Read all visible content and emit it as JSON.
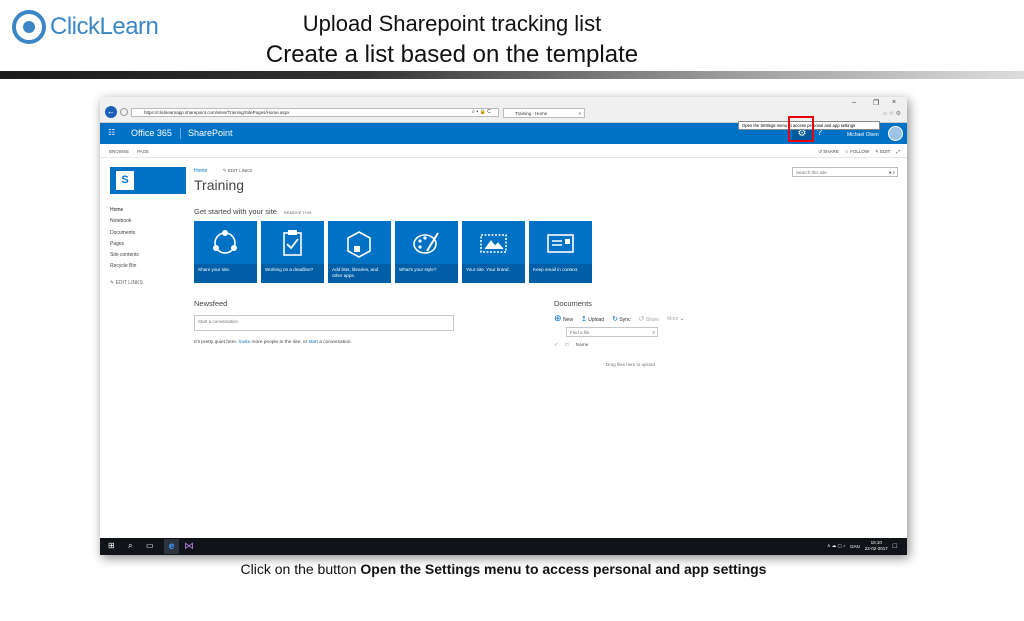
{
  "brand": {
    "logo_text": "ClickLearn"
  },
  "slide": {
    "title": "Upload Sharepoint tracking list",
    "subtitle": "Create a list based on the template",
    "caption_prefix": "Click on the button",
    "caption_target": "Open the Settings menu to access personal and app settings"
  },
  "browser": {
    "url": "https://clicklearnapp.sharepoint.com/sites/Training/SitePages/Home.aspx",
    "address_controls": "⌕ ▾ 🔒 C",
    "tab_title": "Training - Home",
    "tab_close": "×",
    "minimize": "–",
    "restore": "❐",
    "close": "×",
    "tooltip": "Open the Settings menu to access personal and app settings"
  },
  "suitebar": {
    "app_launcher": "☷",
    "office365": "Office 365",
    "app_name": "SharePoint",
    "settings_icon": "⚙",
    "help_icon": "?",
    "user_name": "Michael Olsen"
  },
  "ribbon": {
    "browse": "BROWSE",
    "page": "PAGE",
    "share": "SHARE",
    "follow": "FOLLOW",
    "edit": "EDIT",
    "focus_icon": "⤢"
  },
  "site": {
    "logo_letter": "S",
    "nav_home": "Home",
    "nav_edit_links": "EDIT LINKS",
    "title": "Training",
    "search_placeholder": "Search this site"
  },
  "quicklaunch": {
    "items": [
      "Home",
      "Notebook",
      "Documents",
      "Pages",
      "Site contents",
      "Recycle Bin"
    ],
    "edit_links": "EDIT LINKS"
  },
  "getstarted": {
    "heading": "Get started with your site",
    "remove": "REMOVE THIS",
    "tiles": [
      {
        "caption": "Share your site.",
        "icon": "share-icon"
      },
      {
        "caption": "Working on a deadline?",
        "icon": "clipboard-check-icon"
      },
      {
        "caption": "Add lists, libraries, and other apps.",
        "icon": "add-apps-icon"
      },
      {
        "caption": "What's your style?",
        "icon": "palette-icon"
      },
      {
        "caption": "Your site. Your brand.",
        "icon": "brand-image-icon"
      },
      {
        "caption": "Keep email in context.",
        "icon": "mailbox-icon"
      }
    ]
  },
  "newsfeed": {
    "heading": "Newsfeed",
    "placeholder": "Start a conversation",
    "quiet_prefix": "It's pretty quiet here.",
    "invite": "Invite",
    "quiet_middle": "more people to the site, or",
    "start": "start",
    "quiet_suffix": "a conversation."
  },
  "documents": {
    "heading": "Documents",
    "new": "New",
    "upload": "Upload",
    "sync": "Sync",
    "share": "Share",
    "more": "More",
    "find_placeholder": "Find a file",
    "column_name": "Name",
    "drag_hint": "Drag files here to upload"
  },
  "taskbar": {
    "start_icon": "⊞",
    "search_icon": "⌕",
    "taskview_icon": "▭",
    "ie_icon": "e",
    "vs_icon": "⋈",
    "tray_icons": "∧ ☁ ▢ ♪",
    "language": "DAN",
    "time": "16:10",
    "date": "22-02-2017",
    "notifications_icon": "□"
  }
}
